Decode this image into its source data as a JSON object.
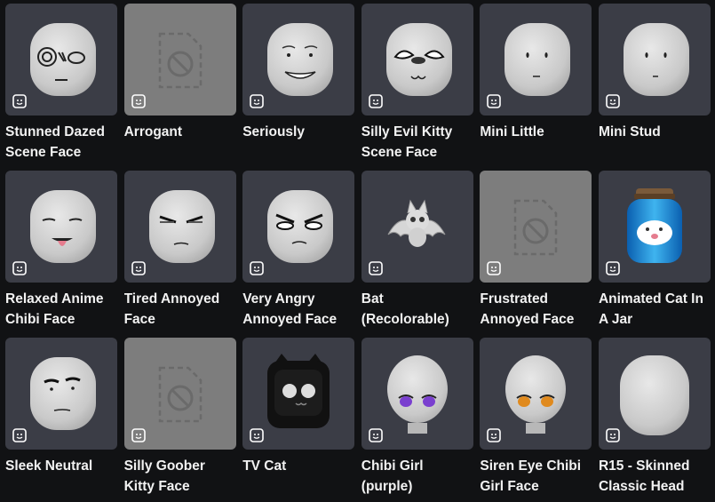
{
  "items": [
    {
      "name": "Stunned Dazed Scene Face",
      "thumb": "head-stunned-face",
      "placeholder": false
    },
    {
      "name": "Arrogant",
      "thumb": "unavailable-image-icon",
      "placeholder": true
    },
    {
      "name": "Seriously",
      "thumb": "head-seriously-face",
      "placeholder": false
    },
    {
      "name": "Silly Evil Kitty Scene Face",
      "thumb": "head-evil-kitty-face",
      "placeholder": false
    },
    {
      "name": "Mini Little",
      "thumb": "head-mini-little",
      "placeholder": false
    },
    {
      "name": "Mini Stud",
      "thumb": "head-mini-stud",
      "placeholder": false
    },
    {
      "name": "Relaxed Anime Chibi Face",
      "thumb": "head-relaxed-face",
      "placeholder": false
    },
    {
      "name": "Tired Annoyed Face",
      "thumb": "head-tired-face",
      "placeholder": false
    },
    {
      "name": "Very Angry Annoyed Face",
      "thumb": "head-angry-face",
      "placeholder": false
    },
    {
      "name": "Bat (Recolorable)",
      "thumb": "bat-accessory",
      "placeholder": false
    },
    {
      "name": "Frustrated Annoyed Face",
      "thumb": "unavailable-image-icon",
      "placeholder": true
    },
    {
      "name": "Animated Cat In A Jar",
      "thumb": "cat-jar",
      "placeholder": false
    },
    {
      "name": "Sleek Neutral",
      "thumb": "head-sleek-neutral",
      "placeholder": false
    },
    {
      "name": "Silly Goober Kitty Face",
      "thumb": "unavailable-image-icon",
      "placeholder": true
    },
    {
      "name": "TV Cat",
      "thumb": "tv-cat-head",
      "placeholder": false
    },
    {
      "name": "Chibi Girl (purple)",
      "thumb": "chibi-girl-purple",
      "placeholder": false
    },
    {
      "name": "Siren Eye Chibi Girl Face",
      "thumb": "chibi-girl-orange",
      "placeholder": false
    },
    {
      "name": "R15 - Skinned Classic Head",
      "thumb": "head-blank",
      "placeholder": false
    }
  ],
  "badge_icon": "dynamic-head-icon",
  "colors": {
    "background": "#111214",
    "card": "#3b3d46",
    "placeholder_card": "#7d7d7d",
    "text": "#f2f2f2"
  }
}
